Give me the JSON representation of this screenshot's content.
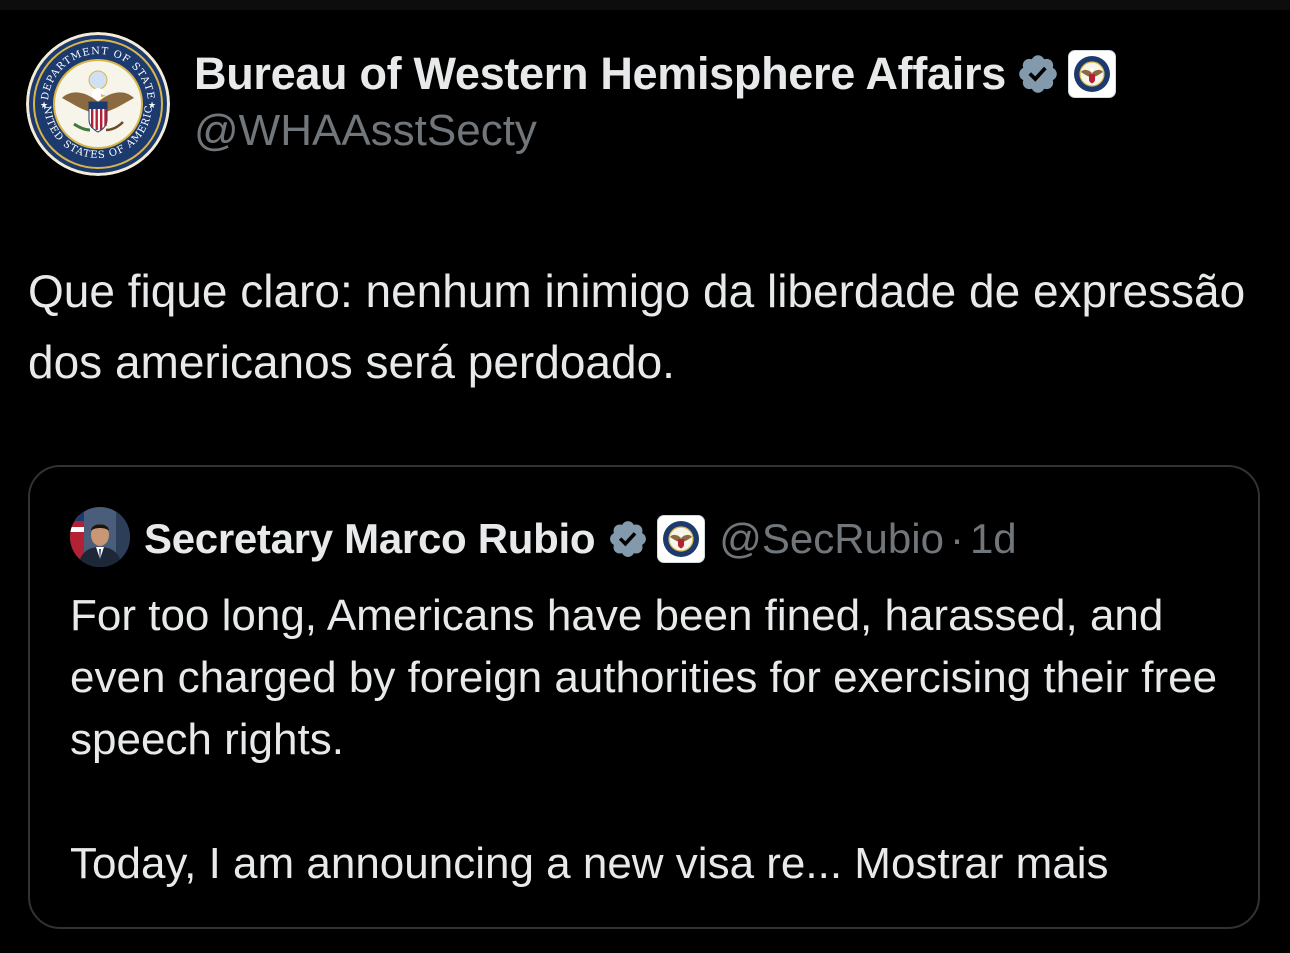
{
  "tweet": {
    "author": {
      "display_name": "Bureau of Western Hemisphere Affairs",
      "handle": "@WHAAsstSecty",
      "avatar_icon": "department-of-state-seal-icon",
      "verified_icon": "verified-badge-icon",
      "affiliation_icon": "state-department-seal-icon",
      "seal_text_top": "DEPARTMENT OF STATE",
      "seal_text_bottom": "UNITED STATES OF AMERICA"
    },
    "text": "Que fique claro: nenhum inimigo da liberdade de expressão dos americanos será perdoado."
  },
  "quoted_tweet": {
    "author": {
      "display_name": "Secretary Marco Rubio",
      "handle": "@SecRubio",
      "avatar_icon": "profile-photo",
      "verified_icon": "verified-badge-icon",
      "affiliation_icon": "state-department-seal-icon"
    },
    "separator": "·",
    "time": "1d",
    "paragraph1": "For too long, Americans have been fined, harassed, and even charged by foreign authorities for exercising their free speech rights.",
    "paragraph2_truncated": "Today, I am announcing a new visa re...",
    "show_more_label": "Mostrar mais"
  },
  "colors": {
    "background": "#000000",
    "text_primary": "#e7e9ea",
    "text_secondary": "#71767b",
    "border": "#2f3336",
    "verified_badge": "#829aab"
  }
}
